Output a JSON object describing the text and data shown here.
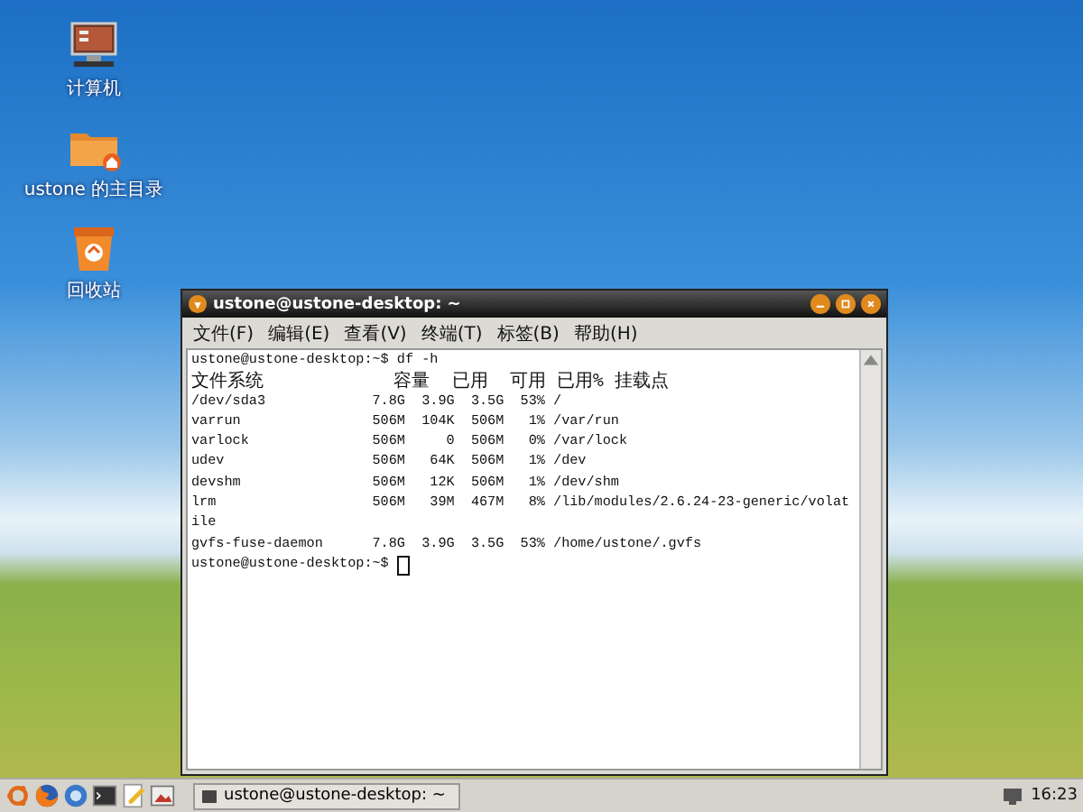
{
  "desktop_icons": [
    {
      "kind": "computer",
      "label": "计算机"
    },
    {
      "kind": "home",
      "label": "ustone 的主目录"
    },
    {
      "kind": "trash",
      "label": "回收站"
    }
  ],
  "window": {
    "title": "ustone@ustone-desktop: ~",
    "menu": [
      "文件(F)",
      "编辑(E)",
      "查看(V)",
      "终端(T)",
      "标签(B)",
      "帮助(H)"
    ],
    "terminal_lines": [
      "ustone@ustone-desktop:~$ df -h",
      "文件系统            容量  已用  可用 已用% 挂载点",
      "/dev/sda3             7.8G  3.9G  3.5G  53% /",
      "varrun                506M  104K  506M   1% /var/run",
      "varlock               506M     0  506M   0% /var/lock",
      "udev                  506M   64K  506M   1% /dev",
      "devshm                506M   12K  506M   1% /dev/shm",
      "lrm                   506M   39M  467M   8% /lib/modules/2.6.24-23-generic/volat",
      "ile",
      "gvfs-fuse-daemon      7.8G  3.9G  3.5G  53% /home/ustone/.gvfs"
    ],
    "prompt": "ustone@ustone-desktop:~$ "
  },
  "taskbar": {
    "launchers": [
      {
        "kind": "ubuntu"
      },
      {
        "kind": "firefox"
      },
      {
        "kind": "mail"
      },
      {
        "kind": "terminal"
      },
      {
        "kind": "editor"
      },
      {
        "kind": "image"
      }
    ],
    "tasks": [
      {
        "label": "ustone@ustone-desktop: ~",
        "selected": false
      }
    ],
    "clock": "16:23"
  }
}
